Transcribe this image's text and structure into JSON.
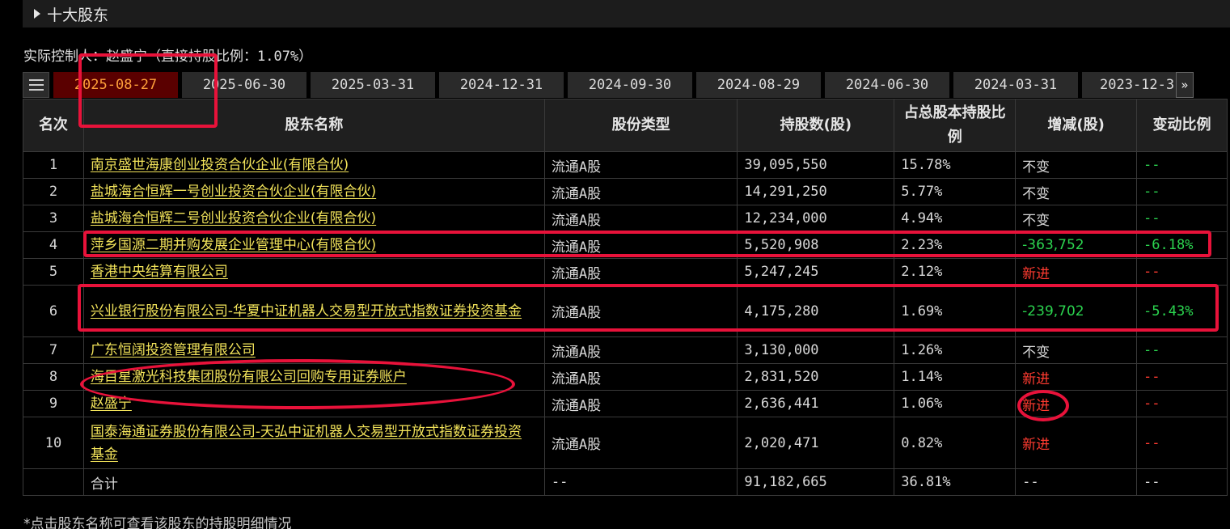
{
  "section": {
    "title": "十大股东"
  },
  "controller": {
    "text": "实际控制人：赵盛宁（直接持股比例：1.07%）"
  },
  "tabs": [
    "2025-08-27",
    "2025-06-30",
    "2025-03-31",
    "2024-12-31",
    "2024-09-30",
    "2024-08-29",
    "2024-06-30",
    "2024-03-31",
    "2023-12-3"
  ],
  "table": {
    "headers": [
      "名次",
      "股东名称",
      "股份类型",
      "持股数(股)",
      "占总股本持股比例",
      "增减(股)",
      "变动比例"
    ],
    "rows": [
      {
        "rank": "1",
        "name": "南京盛世海康创业投资合伙企业(有限合伙)",
        "type": "流通A股",
        "shares": "39,095,550",
        "pct": "15.78%",
        "change": "不变",
        "ratio": "--"
      },
      {
        "rank": "2",
        "name": "盐城海合恒辉一号创业投资合伙企业(有限合伙)",
        "type": "流通A股",
        "shares": "14,291,250",
        "pct": "5.77%",
        "change": "不变",
        "ratio": "--"
      },
      {
        "rank": "3",
        "name": "盐城海合恒辉二号创业投资合伙企业(有限合伙)",
        "type": "流通A股",
        "shares": "12,234,000",
        "pct": "4.94%",
        "change": "不变",
        "ratio": "--"
      },
      {
        "rank": "4",
        "name": "萍乡国源二期并购发展企业管理中心(有限合伙)",
        "type": "流通A股",
        "shares": "5,520,908",
        "pct": "2.23%",
        "change": "-363,752",
        "ratio": "-6.18%"
      },
      {
        "rank": "5",
        "name": "香港中央结算有限公司",
        "type": "流通A股",
        "shares": "5,247,245",
        "pct": "2.12%",
        "change": "新进",
        "ratio": "--"
      },
      {
        "rank": "6",
        "name": "兴业银行股份有限公司-华夏中证机器人交易型开放式指数证券投资基金",
        "type": "流通A股",
        "shares": "4,175,280",
        "pct": "1.69%",
        "change": "-239,702",
        "ratio": "-5.43%"
      },
      {
        "rank": "7",
        "name": "广东恒阔投资管理有限公司",
        "type": "流通A股",
        "shares": "3,130,000",
        "pct": "1.26%",
        "change": "不变",
        "ratio": "--"
      },
      {
        "rank": "8",
        "name": "海目星激光科技集团股份有限公司回购专用证券账户",
        "type": "流通A股",
        "shares": "2,831,520",
        "pct": "1.14%",
        "change": "新进",
        "ratio": "--"
      },
      {
        "rank": "9",
        "name": "赵盛宁",
        "type": "流通A股",
        "shares": "2,636,441",
        "pct": "1.06%",
        "change": "新进",
        "ratio": "--"
      },
      {
        "rank": "10",
        "name": "国泰海通证券股份有限公司-天弘中证机器人交易型开放式指数证券投资基金",
        "type": "流通A股",
        "shares": "2,020,471",
        "pct": "0.82%",
        "change": "新进",
        "ratio": "--"
      }
    ],
    "total": {
      "label": "合计",
      "type": "--",
      "shares": "91,182,665",
      "pct": "36.81%",
      "change": "--",
      "ratio": "--"
    }
  },
  "note": "*点击股东名称可查看该股东的持股明细情况",
  "colors": {
    "increase": "#ff3b30",
    "decrease": "#2bd44f",
    "name_link": "#f2e35a",
    "annotation": "#e8123a"
  }
}
